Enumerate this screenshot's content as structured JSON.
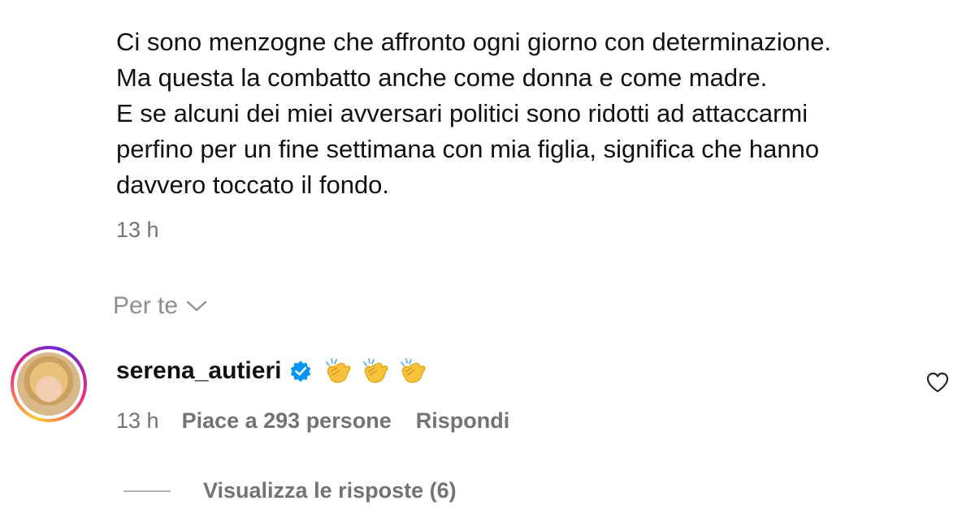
{
  "post": {
    "caption_lines": [
      "Ci sono menzogne che affronto ogni giorno con determinazione.",
      "Ma questa la combatto anche come donna e come madre.",
      "E se alcuni dei miei avversari politici sono ridotti ad attaccarmi",
      "perfino per un fine settimana con mia figlia, significa che hanno",
      "davvero toccato il fondo."
    ],
    "time": "13 h"
  },
  "filter": {
    "label": "Per te",
    "icon": "chevron-down-icon"
  },
  "comment": {
    "username": "serena_autieri",
    "verified": true,
    "emoji": [
      "👏",
      "👏",
      "👏"
    ],
    "time": "13 h",
    "likes_text": "Piace a 293 persone",
    "reply_label": "Rispondi",
    "view_replies_label": "Visualizza le risposte (6)",
    "icons": {
      "verified": "verified-badge-icon",
      "like": "heart-icon",
      "emoji": "clapping-hands-emoji"
    }
  },
  "colors": {
    "text": "#111111",
    "secondary": "#737373",
    "muted": "#8e8e8e",
    "verified": "#0095f6"
  }
}
